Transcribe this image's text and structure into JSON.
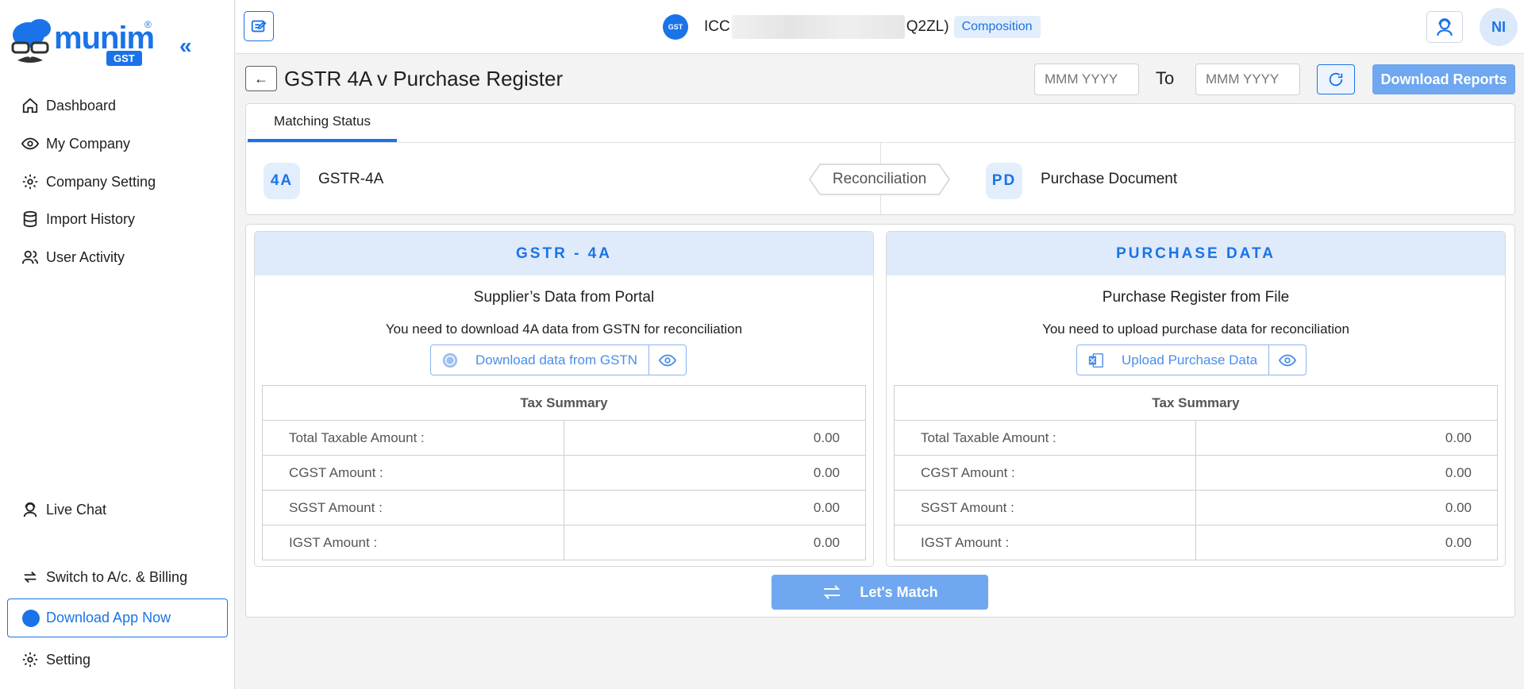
{
  "sidebar": {
    "logo_text": "munim",
    "logo_reg": "®",
    "logo_badge": "GST",
    "items": [
      {
        "label": "Dashboard"
      },
      {
        "label": "My Company"
      },
      {
        "label": "Company Setting"
      },
      {
        "label": "Import History"
      },
      {
        "label": "User Activity"
      }
    ],
    "live_chat": "Live Chat",
    "switch_billing": "Switch to A/c. & Billing",
    "download_app": "Download App Now",
    "setting": "Setting"
  },
  "topbar": {
    "company_prefix": "ICC",
    "company_suffix": "Q2ZL)",
    "company_tag": "Composition",
    "gst_icon_text": "GST",
    "user_initials": "NI"
  },
  "header": {
    "title": "GSTR 4A v Purchase Register",
    "from_placeholder": "MMM YYYY",
    "to_label": "To",
    "to_placeholder": "MMM YYYY",
    "download_reports": "Download Reports"
  },
  "status": {
    "tab_label": "Matching Status",
    "left_badge": "4A",
    "left_label": "GSTR-4A",
    "center_label": "Reconciliation",
    "right_badge": "PD",
    "right_label": "Purchase Document"
  },
  "gstr": {
    "heading": "GSTR - 4A",
    "subtitle": "Supplier’s Data from Portal",
    "note": "You need to download 4A data from GSTN for reconciliation",
    "action": "Download data from GSTN",
    "table_title": "Tax Summary",
    "rows": [
      {
        "label": "Total Taxable Amount :",
        "value": "0.00"
      },
      {
        "label": "CGST Amount :",
        "value": "0.00"
      },
      {
        "label": "SGST Amount :",
        "value": "0.00"
      },
      {
        "label": "IGST Amount :",
        "value": "0.00"
      }
    ]
  },
  "purchase": {
    "heading": "PURCHASE DATA",
    "subtitle": "Purchase Register from File",
    "note": "You need to upload purchase data for reconciliation",
    "action": "Upload Purchase Data",
    "table_title": "Tax Summary",
    "rows": [
      {
        "label": "Total Taxable Amount :",
        "value": "0.00"
      },
      {
        "label": "CGST Amount :",
        "value": "0.00"
      },
      {
        "label": "SGST Amount :",
        "value": "0.00"
      },
      {
        "label": "IGST Amount :",
        "value": "0.00"
      }
    ]
  },
  "match_button": "Let's Match",
  "colors": {
    "accent": "#1a73e8",
    "accent_light": "#6fa7f0",
    "head_bg": "#dfeafa"
  }
}
